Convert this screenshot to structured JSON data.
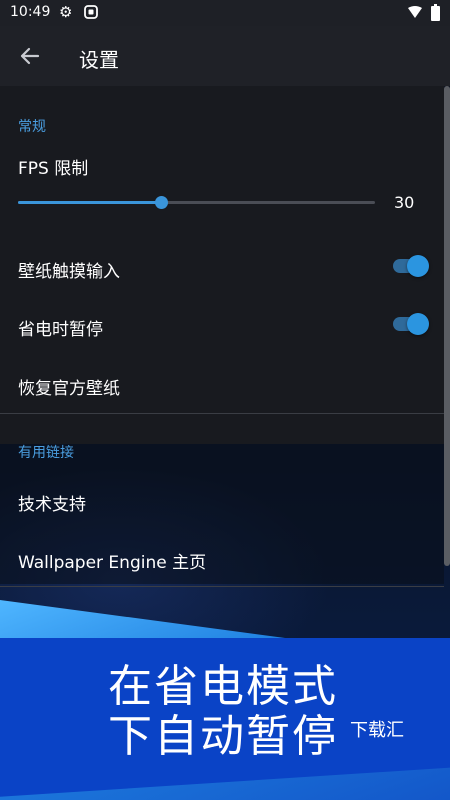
{
  "status_bar": {
    "time": "10:49",
    "icons": [
      "gear-icon",
      "app-notification-icon",
      "wifi-icon",
      "battery-icon"
    ]
  },
  "app_bar": {
    "back_icon": "arrow-left-icon",
    "title": "设置"
  },
  "general": {
    "section_label": "常规",
    "fps": {
      "label": "FPS 限制",
      "value": "30",
      "fraction": 0.4
    },
    "touch_input": {
      "label": "壁纸触摸输入",
      "enabled": true
    },
    "power_save_pause": {
      "label": "省电时暂停",
      "enabled": true
    },
    "restore_official": {
      "label": "恢复官方壁纸"
    }
  },
  "links": {
    "section_label": "有用链接",
    "support": {
      "label": "技术支持"
    },
    "homepage": {
      "label": "Wallpaper Engine 主页"
    }
  },
  "promo": {
    "line1": "在省电模式",
    "line2": "下自动暂停",
    "watermark": "下载汇"
  },
  "colors": {
    "accent": "#3a95da",
    "section_label": "#4a9ee0",
    "banner_blue": "#0a43c6",
    "panel_bg": "#181a1f"
  }
}
